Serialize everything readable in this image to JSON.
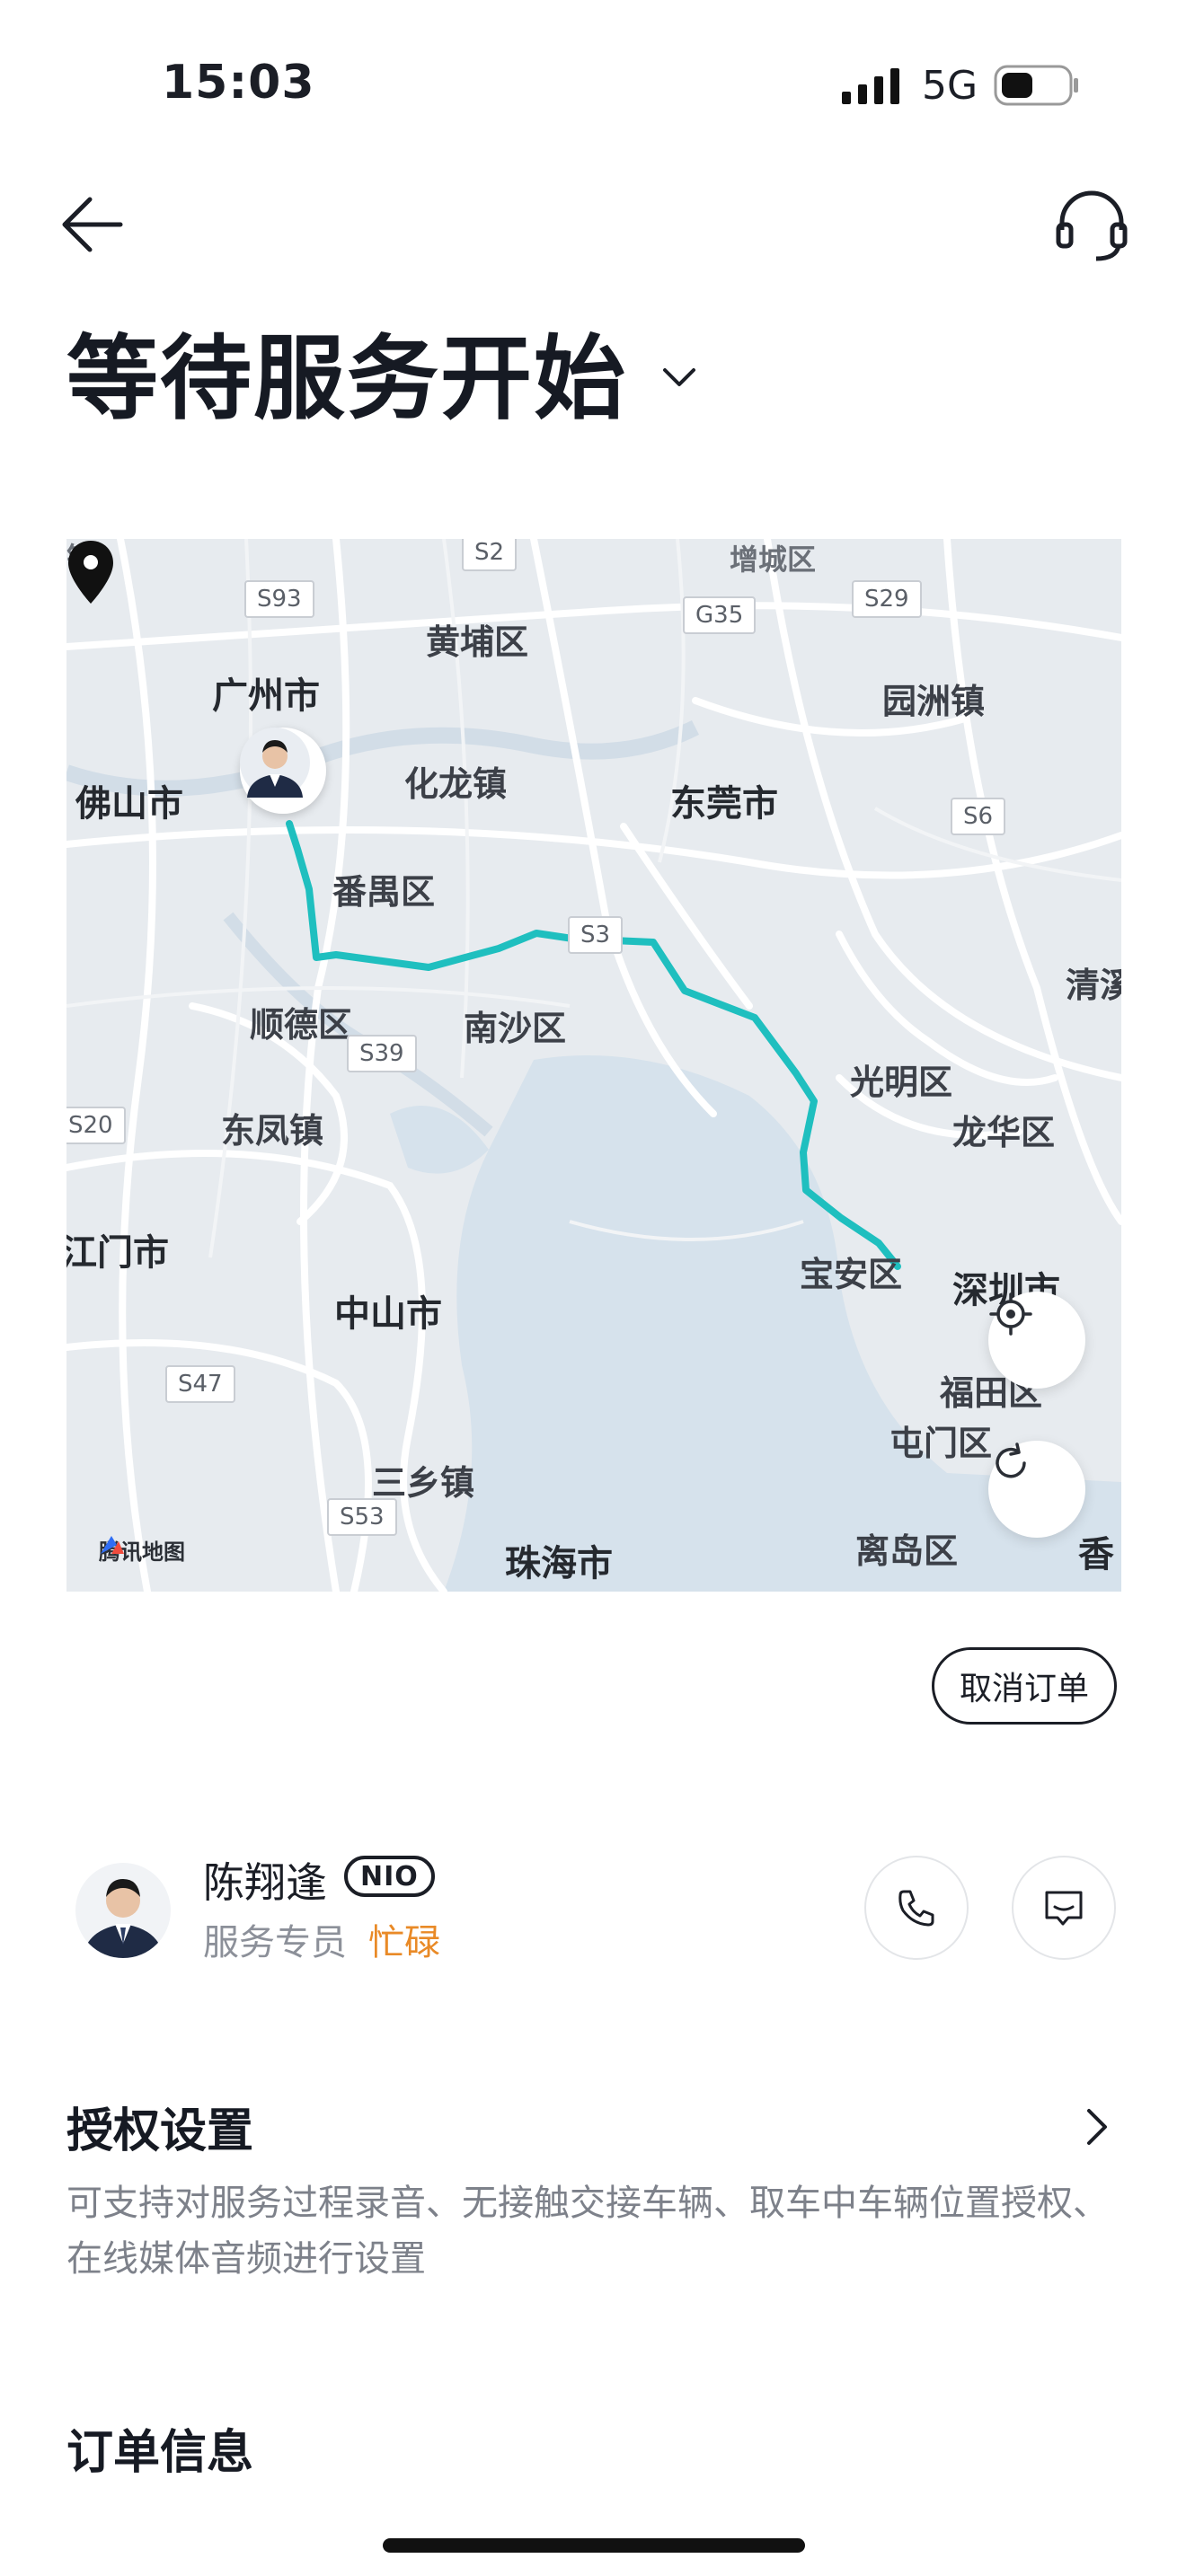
{
  "status_bar": {
    "time": "15:03",
    "network": "5G"
  },
  "header": {
    "title": "等待服务开始"
  },
  "map": {
    "labels": {
      "zengcheng": "增城区",
      "huangpu": "黄埔区",
      "guangzhou": "广州市",
      "foshan": "佛山市",
      "hualong": "化龙镇",
      "dongguan": "东莞市",
      "yuanzhou": "园洲镇",
      "panyu": "番禺区",
      "shunde": "顺德区",
      "nansha": "南沙区",
      "guangming": "光明区",
      "longhua": "龙华区",
      "dongfeng": "东凤镇",
      "jiangmen": "江门市",
      "zhongshan": "中山市",
      "baoan": "宝安区",
      "shenzhen": "深圳市",
      "futian": "福田区",
      "tuenmun": "屯门区",
      "sanxiang": "三乡镇",
      "zhuhai": "珠海市",
      "lidao": "离岛区",
      "qingxi": "清溪",
      "hk": "香"
    },
    "shields": {
      "s2": "S2",
      "s93": "S93",
      "g35": "G35",
      "s29": "S29",
      "s6": "S6",
      "s3": "S3",
      "s39": "S39",
      "s20": "S20",
      "s47": "S47",
      "s53": "S53"
    },
    "attribution": "腾讯地图",
    "route_color": "#1fbfbf"
  },
  "actions": {
    "cancel_label": "取消订单"
  },
  "agent": {
    "name": "陈翔逢",
    "badge": "NIO",
    "role": "服务专员",
    "status": "忙碌"
  },
  "auth": {
    "title": "授权设置",
    "description": "可支持对服务过程录音、无接触交接车辆、取车中车辆位置授权、在线媒体音频进行设置"
  },
  "order": {
    "title": "订单信息"
  },
  "colors": {
    "accent_status": "#e98a27",
    "text_primary": "#1b1e26"
  }
}
